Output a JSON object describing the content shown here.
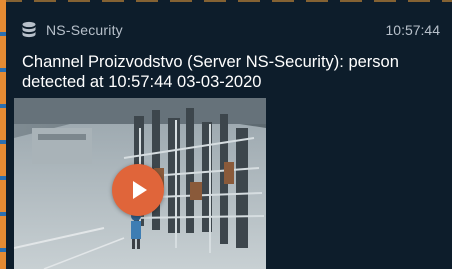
{
  "notification": {
    "app_name": "NS-Security",
    "time": "10:57:44",
    "message": "Channel Proizvodstvo (Server NS-Security): person detected at 10:57:44 03-03-2020"
  },
  "icons": {
    "app": "database-icon",
    "play": "play-icon"
  },
  "colors": {
    "accent": "#e0653a",
    "background": "#0d1d2b",
    "text_primary": "#ffffff",
    "text_secondary": "#b7c0ca"
  }
}
